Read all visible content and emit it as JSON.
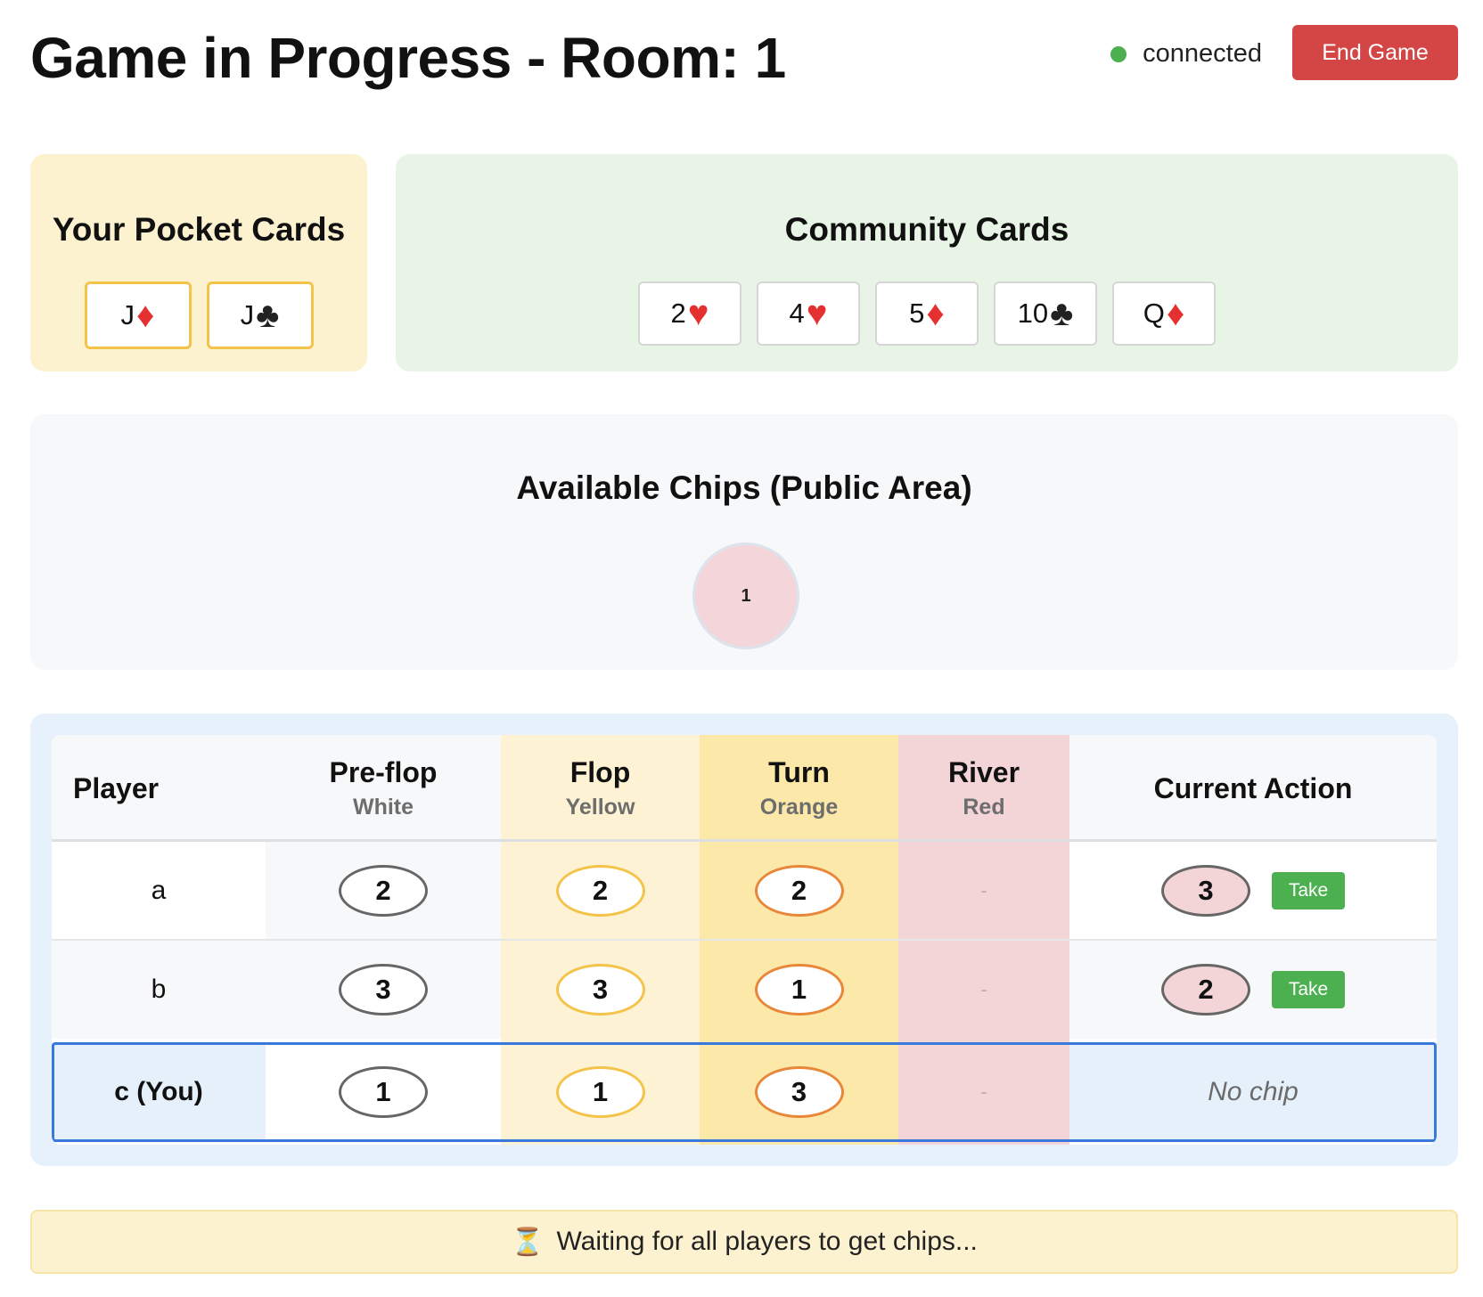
{
  "header": {
    "title": "Game in Progress - Room: 1",
    "status_text": "connected",
    "status_color": "#4caf50",
    "end_button_label": "End Game",
    "end_button_color": "#d44545"
  },
  "pocket": {
    "title": "Your Pocket Cards",
    "cards": [
      {
        "rank": "J",
        "suit": "♦",
        "suit_color": "red"
      },
      {
        "rank": "J",
        "suit": "♣",
        "suit_color": "black"
      }
    ]
  },
  "community": {
    "title": "Community Cards",
    "cards": [
      {
        "rank": "2",
        "suit": "♥",
        "suit_color": "red"
      },
      {
        "rank": "4",
        "suit": "♥",
        "suit_color": "red"
      },
      {
        "rank": "5",
        "suit": "♦",
        "suit_color": "red"
      },
      {
        "rank": "10",
        "suit": "♣",
        "suit_color": "black"
      },
      {
        "rank": "Q",
        "suit": "♦",
        "suit_color": "red"
      }
    ]
  },
  "public_chips": {
    "title": "Available Chips (Public Area)",
    "chips": [
      "1"
    ]
  },
  "table": {
    "columns": {
      "player": "Player",
      "preflop": {
        "label": "Pre-flop",
        "color": "White"
      },
      "flop": {
        "label": "Flop",
        "color": "Yellow"
      },
      "turn": {
        "label": "Turn",
        "color": "Orange"
      },
      "river": {
        "label": "River",
        "color": "Red"
      },
      "action": "Current Action"
    },
    "rows": [
      {
        "player": "a",
        "preflop": "2",
        "flop": "2",
        "turn": "2",
        "river": "-",
        "action_chip": "3",
        "action_button": "Take"
      },
      {
        "player": "b",
        "preflop": "3",
        "flop": "3",
        "turn": "1",
        "river": "-",
        "action_chip": "2",
        "action_button": "Take"
      },
      {
        "player": "c (You)",
        "preflop": "1",
        "flop": "1",
        "turn": "3",
        "river": "-",
        "action_text": "No chip"
      }
    ]
  },
  "waiting": {
    "icon": "hourglass-icon",
    "text": "Waiting for all players to get chips..."
  }
}
